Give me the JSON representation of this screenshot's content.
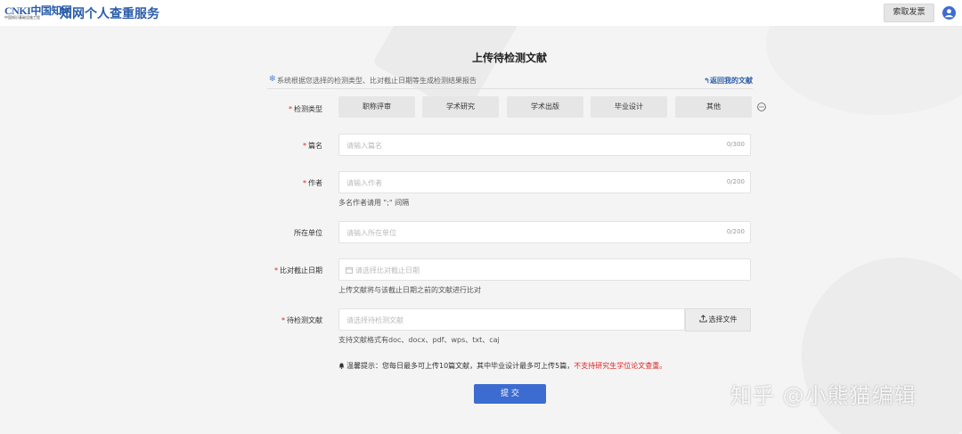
{
  "header": {
    "logo_text": "CNKI中国知网",
    "logo_sub": "中国知识基础设施工程",
    "brand_title": "知网个人查重服务",
    "invoice_button": "索取发票",
    "user_icon": "user-icon"
  },
  "page": {
    "title": "上传待检测文献",
    "info_text": "系统根据您选择的检测类型、比对截止日期等生成检测结果报告",
    "back_link": "返回我的文献"
  },
  "form": {
    "type_label": "检测类型",
    "types": [
      "职称评审",
      "学术研究",
      "学术出版",
      "毕业设计",
      "其他"
    ],
    "title_label": "篇名",
    "title_placeholder": "请输入篇名",
    "title_counter": "0/300",
    "author_label": "作者",
    "author_placeholder": "请输入作者",
    "author_counter": "0/200",
    "author_hint": "多名作者请用 \";\" 间隔",
    "org_label": "所在单位",
    "org_placeholder": "请输入所在单位",
    "org_counter": "0/200",
    "date_label": "比对截止日期",
    "date_placeholder": "请选择比对截止日期",
    "date_hint": "上传文献将与该截止日期之前的文献进行比对",
    "file_label": "待检测文献",
    "file_placeholder": "请选择待检测文献",
    "file_button": "选择文件",
    "file_hint": "支持文献格式有doc、docx、pdf、wps、txt、caj",
    "notice_text": "温馨提示：您每日最多可上传10篇文献，其中毕业设计最多可上传5篇，",
    "notice_red": "不支持研究生学位论文查重。",
    "submit": "提 交"
  },
  "watermark": "知乎 @小熊猫编辑",
  "colors": {
    "brand": "#2a5caa",
    "primary": "#3d6cd1",
    "required": "#e02020"
  }
}
